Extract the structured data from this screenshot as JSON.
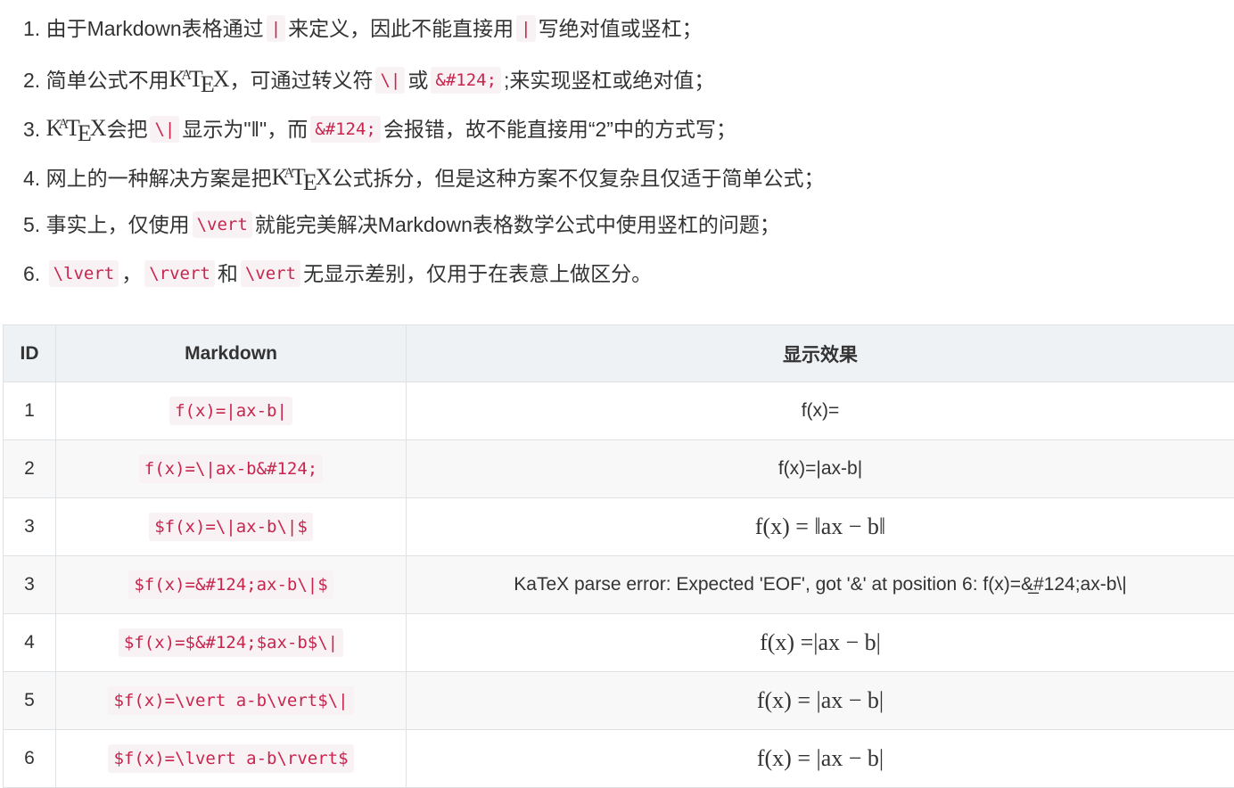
{
  "notes": [
    {
      "num": "1.",
      "a": "由于Markdown表格通过",
      "code1": "|",
      "b": "来定义，因此不能直接用",
      "code2": "|",
      "c": "写绝对值或竖杠；"
    },
    {
      "num": "2.",
      "a": "简单公式不用",
      "tex": "KaTeX",
      "b": "，可通过转义符",
      "code1": "\\|",
      "c": "或",
      "code2": "&#124;",
      "d": ";来实现竖杠或绝对值；"
    },
    {
      "num": "3.",
      "tex": "KaTeX",
      "a": "会把",
      "code1": "\\|",
      "b": "显示为\"‖\"，而",
      "code2": "&#124;",
      "c": "会报错，故不能直接用“2”中的方式写；"
    },
    {
      "num": "4.",
      "a": "网上的一种解决方案是把",
      "tex": "KaTeX",
      "b": "公式拆分，但是这种方案不仅复杂且仅适于简单公式；"
    },
    {
      "num": "5.",
      "a": "事实上，仅使用",
      "code1": "\\vert",
      "b": "就能完美解决Markdown表格数学公式中使用竖杠的问题；"
    },
    {
      "num": "6.",
      "code1": "\\lvert",
      "a": "，",
      "code2": "\\rvert",
      "b": "和",
      "code3": "\\vert",
      "c": "无显示差别，仅用于在表意上做区分。"
    }
  ],
  "table": {
    "headers": {
      "id": "ID",
      "markdown": "Markdown",
      "result": "显示效果"
    },
    "rows": [
      {
        "id": "1",
        "markdown": "f(x)=|ax-b|",
        "result": "f(x)=",
        "style": "plain"
      },
      {
        "id": "2",
        "markdown": "f(x)=\\|ax-b&#124;",
        "result": "f(x)=|ax-b|",
        "style": "plain"
      },
      {
        "id": "3",
        "markdown": "$f(x)=\\|ax-b\\|$",
        "result": "f(x) = ‖ax − b‖",
        "style": "math"
      },
      {
        "id": "3",
        "markdown": "$f(x)=&#124;ax-b\\|$",
        "result": "KaTeX parse error: Expected 'EOF', got '&' at position 6: f(x)=&̲#124;ax-b\\|",
        "style": "error"
      },
      {
        "id": "4",
        "markdown": "$f(x)=$&#124;$ax-b$\\|",
        "result": "f(x) =|ax − b|",
        "style": "math"
      },
      {
        "id": "5",
        "markdown": "$f(x)=\\vert a-b\\vert$\\|",
        "result": "f(x) = |ax − b|",
        "style": "math"
      },
      {
        "id": "6",
        "markdown": "$f(x)=\\lvert a-b\\rvert$",
        "result": "f(x) = |ax − b|",
        "style": "math"
      }
    ]
  }
}
